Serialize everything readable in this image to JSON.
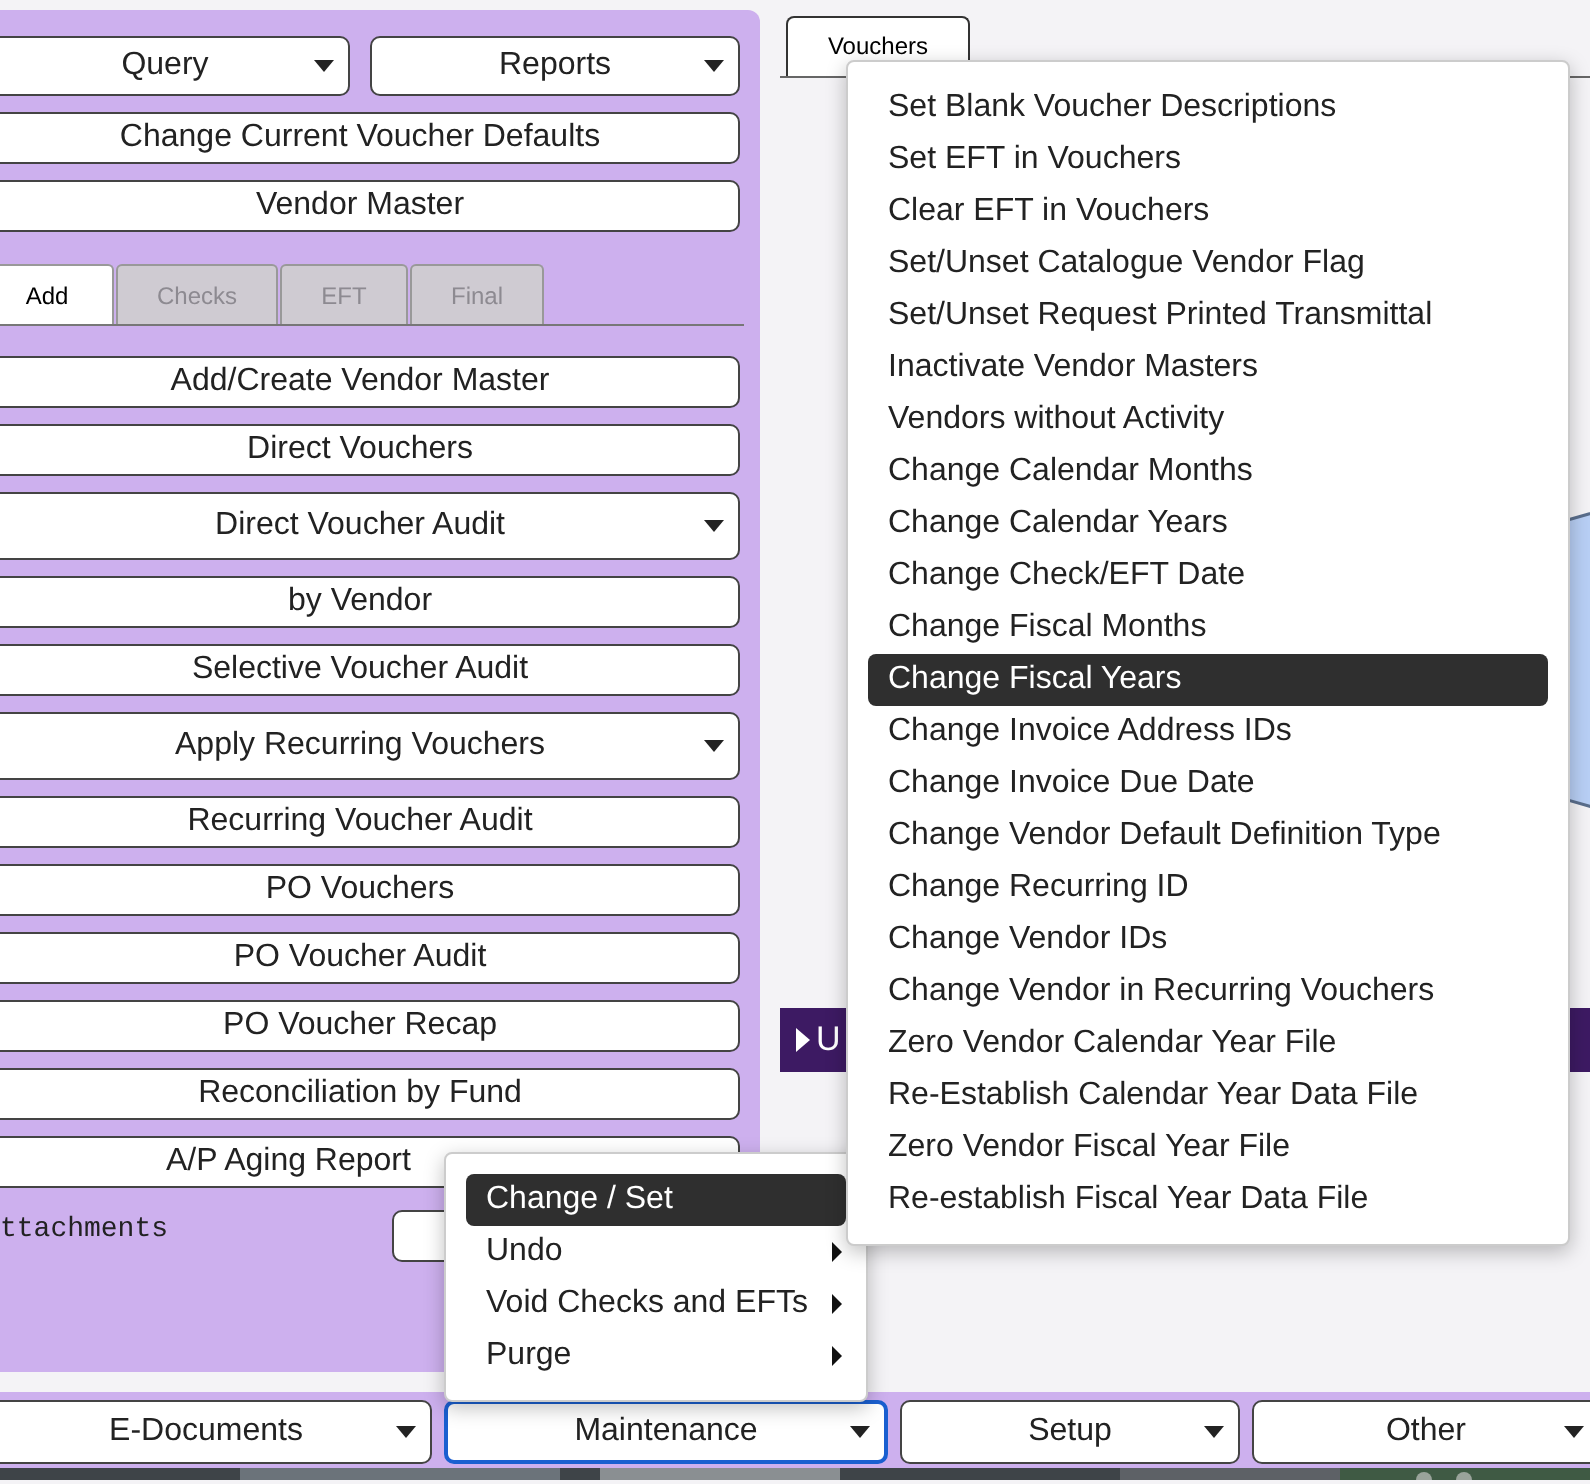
{
  "left_panel": {
    "top_buttons": [
      {
        "label": "Query",
        "kind": "dropdown"
      },
      {
        "label": "Reports",
        "kind": "dropdown"
      }
    ],
    "wide_buttons": [
      {
        "label": "Change Current Voucher Defaults"
      },
      {
        "label": "Vendor Master"
      }
    ],
    "tabs": [
      {
        "label": "Add",
        "selected": true
      },
      {
        "label": "Checks",
        "selected": false
      },
      {
        "label": "EFT",
        "selected": false
      },
      {
        "label": "Final",
        "selected": false
      }
    ],
    "actions": [
      {
        "label": "Add/Create Vendor Master",
        "kind": "plain"
      },
      {
        "label": "Direct Vouchers",
        "kind": "plain"
      },
      {
        "label": "Direct Voucher Audit",
        "kind": "dropdown"
      },
      {
        "label": "by Vendor",
        "kind": "plain"
      },
      {
        "label": "Selective Voucher Audit",
        "kind": "plain"
      },
      {
        "label": "Apply Recurring Vouchers",
        "kind": "dropdown"
      },
      {
        "label": "Recurring Voucher Audit",
        "kind": "plain"
      },
      {
        "label": "PO Vouchers",
        "kind": "plain"
      },
      {
        "label": "PO Voucher Audit",
        "kind": "plain"
      },
      {
        "label": "PO Voucher Recap",
        "kind": "plain"
      },
      {
        "label": "Reconciliation by Fund",
        "kind": "plain"
      },
      {
        "label": "A/P Aging Report",
        "kind": "plain"
      }
    ],
    "attachments_label": "ttachments"
  },
  "vouchers_pane": {
    "tabs": [
      {
        "label": "Vouchers",
        "selected": true
      }
    ],
    "section_header": {
      "label": "U",
      "expanded": false
    }
  },
  "bottom_bar": {
    "buttons": [
      {
        "label": "E-Documents",
        "focused": false
      },
      {
        "label": "Maintenance",
        "focused": true
      },
      {
        "label": "Setup",
        "focused": false
      },
      {
        "label": "Other",
        "focused": false
      }
    ]
  },
  "maintenance_menu": {
    "items": [
      {
        "label": "Change / Set",
        "selected": true,
        "has_submenu": false
      },
      {
        "label": "Undo",
        "selected": false,
        "has_submenu": true
      },
      {
        "label": "Void Checks and EFTs",
        "selected": false,
        "has_submenu": true
      },
      {
        "label": "Purge",
        "selected": false,
        "has_submenu": true
      }
    ]
  },
  "change_set_menu": {
    "items": [
      {
        "label": "Set Blank Voucher Descriptions",
        "selected": false
      },
      {
        "label": "Set EFT in Vouchers",
        "selected": false
      },
      {
        "label": "Clear EFT in Vouchers",
        "selected": false
      },
      {
        "label": "Set/Unset Catalogue Vendor Flag",
        "selected": false
      },
      {
        "label": "Set/Unset Request Printed Transmittal",
        "selected": false
      },
      {
        "label": "Inactivate Vendor Masters",
        "selected": false
      },
      {
        "label": "Vendors without Activity",
        "selected": false
      },
      {
        "label": "Change Calendar Months",
        "selected": false
      },
      {
        "label": "Change Calendar Years",
        "selected": false
      },
      {
        "label": "Change Check/EFT Date",
        "selected": false
      },
      {
        "label": "Change Fiscal Months",
        "selected": false
      },
      {
        "label": "Change Fiscal Years",
        "selected": true
      },
      {
        "label": "Change Invoice Address IDs",
        "selected": false
      },
      {
        "label": "Change Invoice Due Date",
        "selected": false
      },
      {
        "label": "Change Vendor Default Definition Type",
        "selected": false
      },
      {
        "label": "Change Recurring ID",
        "selected": false
      },
      {
        "label": "Change Vendor IDs",
        "selected": false
      },
      {
        "label": "Change Vendor in Recurring Vouchers",
        "selected": false
      },
      {
        "label": "Zero Vendor Calendar Year File",
        "selected": false
      },
      {
        "label": "Re-Establish Calendar Year Data File",
        "selected": false
      },
      {
        "label": "Zero Vendor Fiscal Year File",
        "selected": false
      },
      {
        "label": "Re-establish Fiscal Year Data File",
        "selected": false
      }
    ]
  }
}
